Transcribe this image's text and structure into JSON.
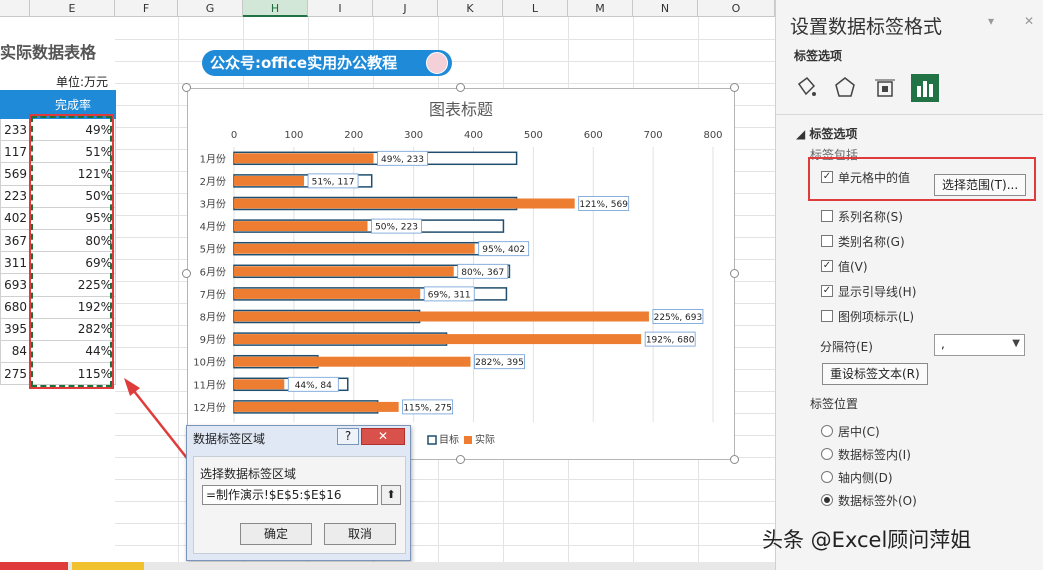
{
  "sheet": {
    "columns": [
      "E",
      "F",
      "G",
      "H",
      "I",
      "J",
      "K",
      "L",
      "M",
      "N",
      "O"
    ],
    "selected_column": "H",
    "title_fragment": "实际数据表格",
    "unit": "单位:万元",
    "header_col2": "完成率",
    "rows": [
      {
        "actual": "233",
        "rate": "49%"
      },
      {
        "actual": "117",
        "rate": "51%"
      },
      {
        "actual": "569",
        "rate": "121%"
      },
      {
        "actual": "223",
        "rate": "50%"
      },
      {
        "actual": "402",
        "rate": "95%"
      },
      {
        "actual": "367",
        "rate": "80%"
      },
      {
        "actual": "311",
        "rate": "69%"
      },
      {
        "actual": "693",
        "rate": "225%"
      },
      {
        "actual": "680",
        "rate": "192%"
      },
      {
        "actual": "395",
        "rate": "282%"
      },
      {
        "actual": "84",
        "rate": "44%"
      },
      {
        "actual": "275",
        "rate": "115%"
      }
    ]
  },
  "banner": "公众号:office实用办公教程",
  "chart_data": {
    "type": "bar",
    "orientation": "horizontal",
    "title": "图表标题",
    "categories": [
      "1月份",
      "2月份",
      "3月份",
      "4月份",
      "5月份",
      "6月份",
      "7月份",
      "8月份",
      "9月份",
      "10月份",
      "11月份",
      "12月份"
    ],
    "series": [
      {
        "name": "目标",
        "values": [
          472,
          230,
          472,
          450,
          475,
          460,
          455,
          310,
          355,
          140,
          190,
          240
        ],
        "color": "#ffffff",
        "stroke": "#1f4e6e"
      },
      {
        "name": "实际",
        "values": [
          233,
          117,
          569,
          223,
          402,
          367,
          311,
          693,
          680,
          395,
          84,
          275
        ],
        "color": "#ed7d31"
      }
    ],
    "labels": [
      "49%, 233",
      "51%, 117",
      "121%, 569",
      "50%, 223",
      "95%, 402",
      "80%, 367",
      "69%, 311",
      "225%, 693",
      "192%, 680",
      "282%, 395",
      "44%, 84",
      "115%, 275"
    ],
    "xlim": [
      0,
      800
    ],
    "xticks": [
      0,
      100,
      200,
      300,
      400,
      500,
      600,
      700,
      800
    ],
    "grid": true,
    "legend": "bottom"
  },
  "dialog": {
    "title": "数据标签区域",
    "help": "?",
    "close": "✕",
    "label": "选择数据标签区域",
    "value": "=制作演示!$E$5:$E$16",
    "ok": "确定",
    "cancel": "取消"
  },
  "pane": {
    "title": "设置数据标签格式",
    "subtitle": "标签选项",
    "section": "标签选项",
    "label_contains": "标签包括",
    "options": [
      {
        "label": "单元格中的值",
        "checked": true
      },
      {
        "label": "系列名称(S)",
        "checked": false
      },
      {
        "label": "类别名称(G)",
        "checked": false
      },
      {
        "label": "值(V)",
        "checked": true
      },
      {
        "label": "显示引导线(H)",
        "checked": true
      },
      {
        "label": "图例项标示(L)",
        "checked": false
      }
    ],
    "select_range": "选择范围(T)...",
    "separator_label": "分隔符(E)",
    "separator_value": ",",
    "reset": "重设标签文本(R)",
    "position_label": "标签位置",
    "positions": [
      {
        "label": "居中(C)",
        "on": false
      },
      {
        "label": "数据标签内(I)",
        "on": false
      },
      {
        "label": "轴内侧(D)",
        "on": false
      },
      {
        "label": "数据标签外(O)",
        "on": true
      }
    ],
    "minimize": "▾",
    "close": "✕"
  },
  "watermark": "头条 @Excel顾问萍姐",
  "colors": {
    "accent": "#1f8ad8",
    "excel_green": "#217346",
    "alert_red": "#e03b3b",
    "bar_orange": "#ed7d31"
  }
}
